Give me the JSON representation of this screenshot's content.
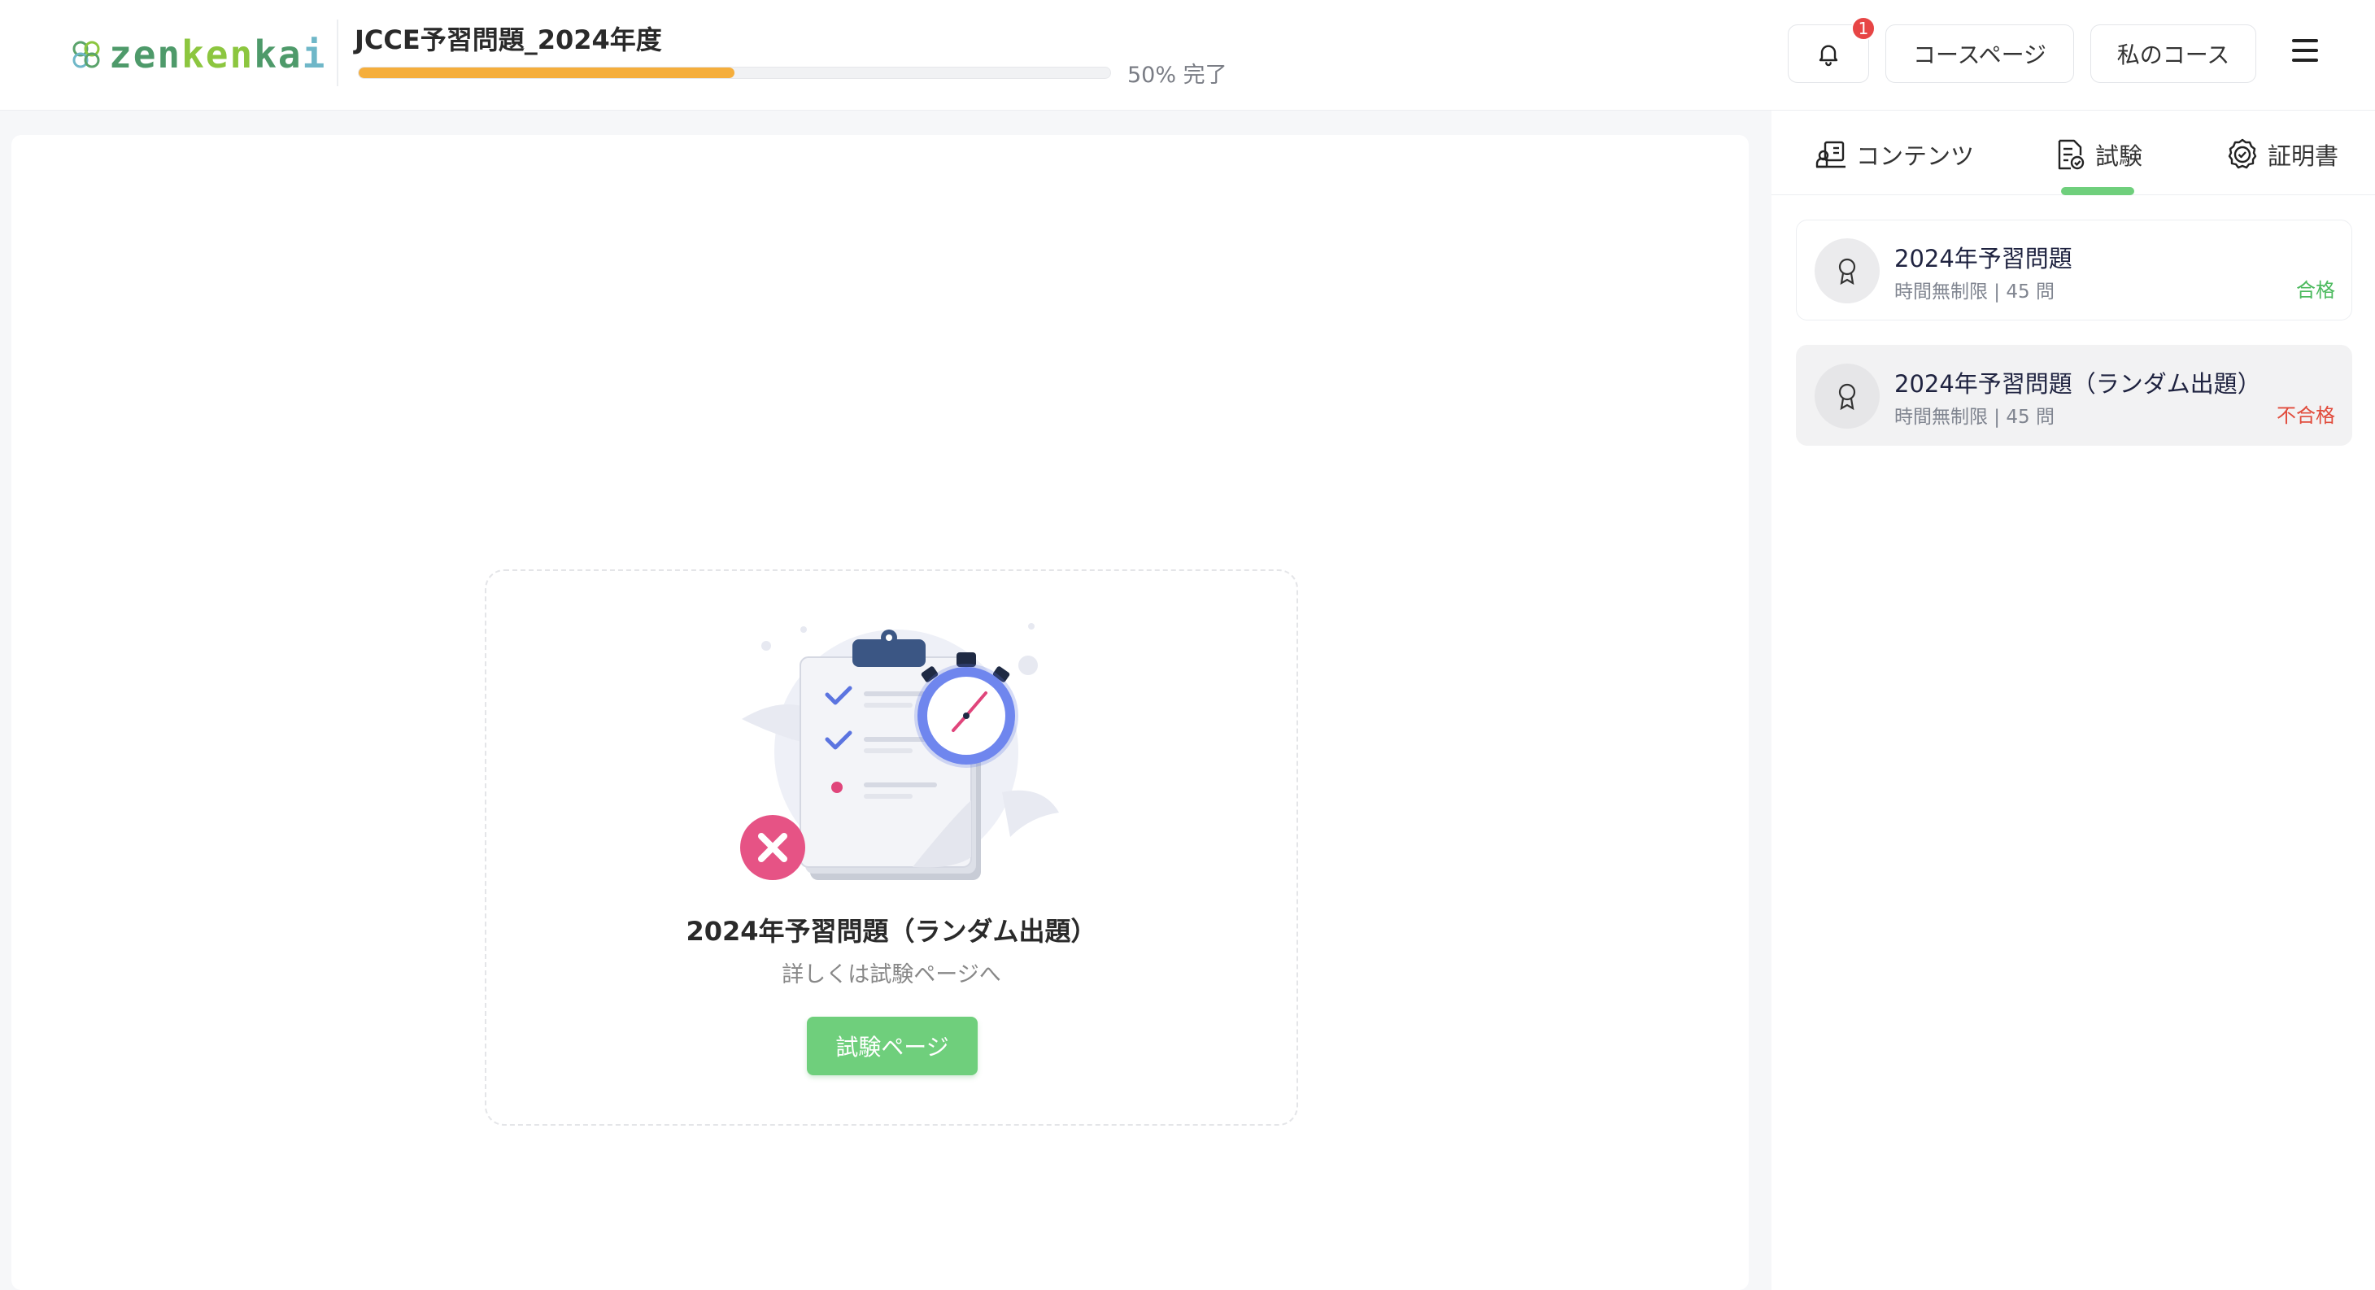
{
  "header": {
    "logo_text_parts": [
      "zen",
      "ken",
      "ka",
      "i"
    ],
    "course_title": "JCCE予習問題_2024年度",
    "progress_text": "50% 完了",
    "progress_percent": 50,
    "notification_count": "1",
    "course_page_label": "コースページ",
    "my_course_label": "私のコース"
  },
  "main": {
    "exam_title": "2024年予習問題（ランダム出題）",
    "exam_subtitle": "詳しくは試験ページへ",
    "exam_button_label": "試験ページ"
  },
  "sidebar": {
    "tabs": [
      {
        "label": "コンテンツ",
        "icon": "content-icon"
      },
      {
        "label": "試験",
        "icon": "exam-icon",
        "active": true
      },
      {
        "label": "証明書",
        "icon": "certificate-icon"
      }
    ],
    "exams": [
      {
        "title": "2024年予習問題",
        "meta": "時間無制限 | 45 問",
        "status": "合格"
      },
      {
        "title": "2024年予習問題（ランダム出題）",
        "meta": "時間無制限 | 45 問",
        "status": "不合格"
      }
    ]
  },
  "colors": {
    "accent_green": "#6fcf7c",
    "progress_orange": "#f5ae3c",
    "pass_green": "#4cba5e",
    "fail_red": "#e14b3b",
    "badge_red": "#e74545"
  }
}
